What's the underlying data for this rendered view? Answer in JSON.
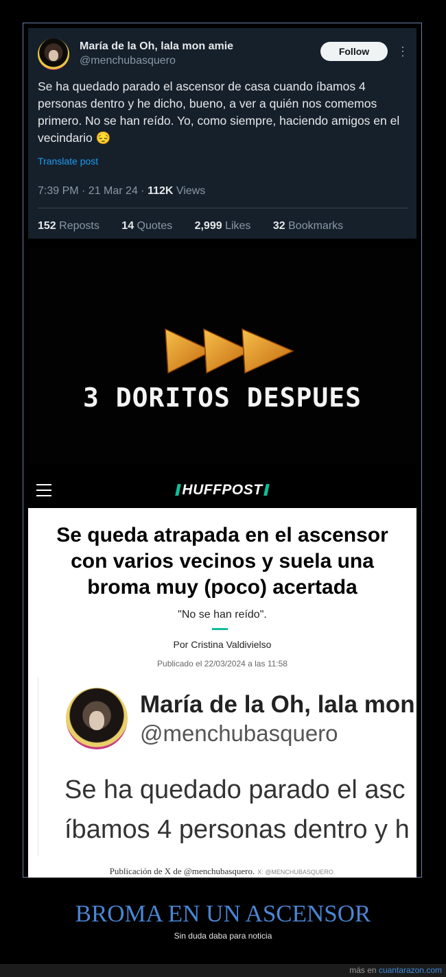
{
  "tweet": {
    "author_name": "María de la Oh, lala mon amie",
    "handle": "@menchubasquero",
    "follow_label": "Follow",
    "more_glyph": "⋮",
    "text": "Se ha quedado parado el ascensor de casa cuando íbamos 4 personas dentro y he dicho, bueno, a ver a quién nos comemos primero. No se han reído. Yo, como siempre, haciendo amigos en el vecindario 😔",
    "translate_label": "Translate post",
    "time": "7:39 PM · 21 Mar 24 · ",
    "views_count": "112K",
    "views_label": " Views",
    "stats": [
      {
        "count": "152",
        "label": " Reposts"
      },
      {
        "count": "14",
        "label": " Quotes"
      },
      {
        "count": "2,999",
        "label": " Likes"
      },
      {
        "count": "32",
        "label": " Bookmarks"
      }
    ]
  },
  "doritos": {
    "caption": "3 DORITOS DESPUES",
    "chip_color": "#e59a1c"
  },
  "huffpost": {
    "logo": "HUFFPOST",
    "accent_color": "#0dbe98",
    "headline": "Se queda atrapada en el ascensor con varios vecinos y suela una broma muy (poco) acertada",
    "subtitle": "\"No se han reído\".",
    "author": "Por Cristina Valdivielso",
    "published": "Publicado el 22/03/2024 a las 11:58",
    "embed": {
      "name": "María de la Oh, lala mon a",
      "handle": "@menchubasquero",
      "line1": "Se ha quedado parado el asc",
      "line2": "íbamos 4 personas dentro y h"
    },
    "caption": "Publicación de X de @menchubasquero.",
    "caption_credit": "X: @MENCHUBASQUERO."
  },
  "post": {
    "title": "BROMA EN UN ASCENSOR",
    "subtitle": "Sin duda daba para noticia",
    "more_prefix": "más en ",
    "site": "cuantarazon.com"
  }
}
